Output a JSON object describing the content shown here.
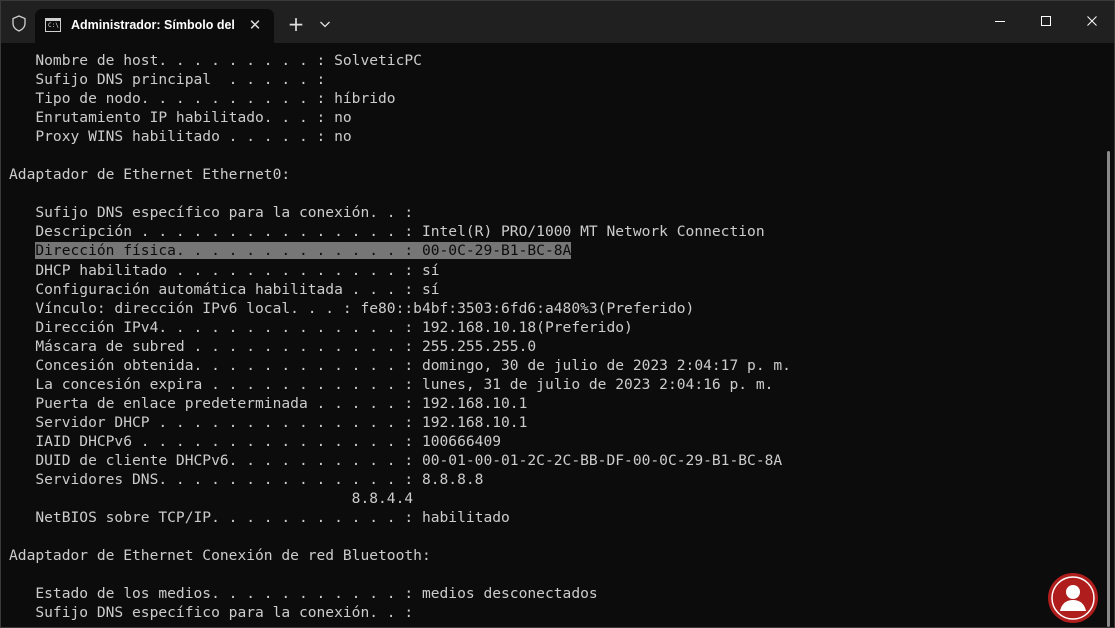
{
  "titlebar": {
    "tab_title": "Administrador: Símbolo del si",
    "tab_icon_glyph": "C:\\",
    "close_glyph": "✕",
    "new_tab_glyph": "+"
  },
  "console": {
    "lines": [
      {
        "text": "   Nombre de host. . . . . . . . . : SolveticPC"
      },
      {
        "text": "   Sufijo DNS principal  . . . . . : "
      },
      {
        "text": "   Tipo de nodo. . . . . . . . . . : híbrido"
      },
      {
        "text": "   Enrutamiento IP habilitado. . . : no"
      },
      {
        "text": "   Proxy WINS habilitado . . . . . : no"
      },
      {
        "text": ""
      },
      {
        "text": "Adaptador de Ethernet Ethernet0:"
      },
      {
        "text": ""
      },
      {
        "text": "   Sufijo DNS específico para la conexión. . : "
      },
      {
        "text": "   Descripción . . . . . . . . . . . . . . . : Intel(R) PRO/1000 MT Network Connection"
      },
      {
        "pre": "   ",
        "highlight": "Dirección física. . . . . . . . . . . . . : 00-0C-29-B1-BC-8A",
        "post": ""
      },
      {
        "text": "   DHCP habilitado . . . . . . . . . . . . . : sí"
      },
      {
        "text": "   Configuración automática habilitada . . . : sí"
      },
      {
        "text": "   Vínculo: dirección IPv6 local. . . : fe80::b4bf:3503:6fd6:a480%3(Preferido)"
      },
      {
        "text": "   Dirección IPv4. . . . . . . . . . . . . . : 192.168.10.18(Preferido)"
      },
      {
        "text": "   Máscara de subred . . . . . . . . . . . . : 255.255.255.0"
      },
      {
        "text": "   Concesión obtenida. . . . . . . . . . . . : domingo, 30 de julio de 2023 2:04:17 p. m."
      },
      {
        "text": "   La concesión expira . . . . . . . . . . . : lunes, 31 de julio de 2023 2:04:16 p. m."
      },
      {
        "text": "   Puerta de enlace predeterminada . . . . . : 192.168.10.1"
      },
      {
        "text": "   Servidor DHCP . . . . . . . . . . . . . . : 192.168.10.1"
      },
      {
        "text": "   IAID DHCPv6 . . . . . . . . . . . . . . . : 100666409"
      },
      {
        "text": "   DUID de cliente DHCPv6. . . . . . . . . . : 00-01-00-01-2C-2C-BB-DF-00-0C-29-B1-BC-8A"
      },
      {
        "text": "   Servidores DNS. . . . . . . . . . . . . . : 8.8.8.8"
      },
      {
        "text": "                                       8.8.4.4"
      },
      {
        "text": "   NetBIOS sobre TCP/IP. . . . . . . . . . . : habilitado"
      },
      {
        "text": ""
      },
      {
        "text": "Adaptador de Ethernet Conexión de red Bluetooth:"
      },
      {
        "text": ""
      },
      {
        "text": "   Estado de los medios. . . . . . . . . . . : medios desconectados"
      },
      {
        "text": "   Sufijo DNS específico para la conexión. . : "
      }
    ]
  },
  "colors": {
    "background": "#0c0c0c",
    "titlebar": "#202020",
    "foreground": "#cccccc",
    "selection": "#767676"
  },
  "icons": {
    "shield": "shield-icon",
    "tab": "command-prompt-icon",
    "dropdown": "chevron-down-icon",
    "minimize": "minimize-icon",
    "maximize": "maximize-icon",
    "close": "close-icon",
    "watermark": "solvetic-logo-icon"
  }
}
